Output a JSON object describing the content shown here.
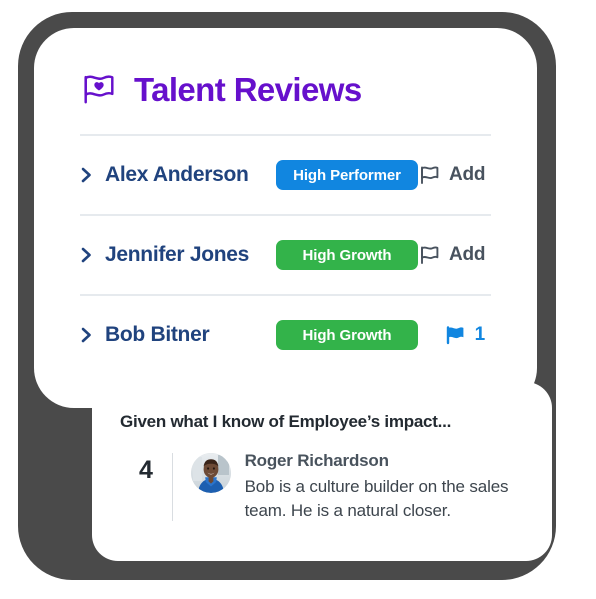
{
  "colors": {
    "frame": "#4a4a4a",
    "card": "#ffffff",
    "brand_purple": "#6610cc",
    "name_navy": "#20437e",
    "badge_blue": "#1186e0",
    "badge_green": "#33b34a",
    "divider": "#e6eaee",
    "text_dark": "#232a31",
    "text_gray": "#49535d"
  },
  "header": {
    "icon": "flag-heart-icon",
    "title": "Talent Reviews"
  },
  "rows": [
    {
      "chevron_icon": "chevron-right-icon",
      "name": "Alex Anderson",
      "badge_label": "High Performer",
      "badge_color": "blue",
      "flag_icon": "flag-outline-icon",
      "action_label": "Add",
      "action_type": "add"
    },
    {
      "chevron_icon": "chevron-right-icon",
      "name": "Jennifer Jones",
      "badge_label": "High Growth",
      "badge_color": "green",
      "flag_icon": "flag-outline-icon",
      "action_label": "Add",
      "action_type": "add"
    },
    {
      "chevron_icon": "chevron-right-icon",
      "name": "Bob Bitner",
      "badge_label": "High Growth",
      "badge_color": "green",
      "flag_icon": "flag-filled-icon",
      "action_label": "1",
      "action_type": "count"
    }
  ],
  "review_card": {
    "question": "Given what I know of Employee’s impact...",
    "rating": "4",
    "reviewer_name": "Roger Richardson",
    "comment": "Bob is a culture builder on the sales team. He is a natural closer.",
    "avatar": "user-photo-avatar"
  }
}
